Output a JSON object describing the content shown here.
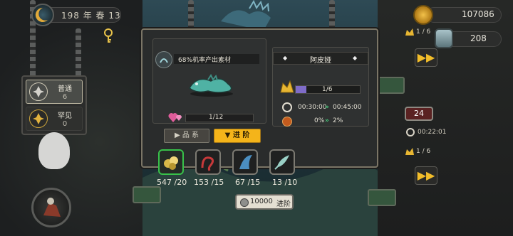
{
  "status_bar": {
    "date": "198 年 春 13"
  },
  "resources": {
    "gold": "107086",
    "jars": "208",
    "level_tag_top": "1 / 6",
    "timer_badge": "24",
    "timer_value": "00:22:01",
    "level_tag_bottom": "1 / 6"
  },
  "rarity": [
    {
      "name": "普通",
      "count": "6",
      "selected": true
    },
    {
      "name": "罕见",
      "count": "0",
      "selected": false
    }
  ],
  "dialog": {
    "rate_label": "68%机率产出素材",
    "hearts": "1/12",
    "creature_name": "阿皮娅",
    "level": "1/6",
    "level_fraction": 0.17,
    "time_current": "00:30:00",
    "time_next": "00:45:00",
    "rate_current": "0%",
    "rate_next": "2%",
    "tabs": [
      {
        "label": "品 系",
        "icon": "play-icon",
        "active": false
      },
      {
        "label": "进 阶",
        "icon": "triangle-down-icon",
        "active": true
      }
    ],
    "materials": [
      {
        "have": "547",
        "need": "/20",
        "icon": "gold-nugget-icon",
        "selected": true
      },
      {
        "have": "153",
        "need": "/15",
        "icon": "red-worm-icon",
        "selected": false
      },
      {
        "have": "67",
        "need": "/15",
        "icon": "blue-fin-icon",
        "selected": false
      },
      {
        "have": "13",
        "need": "/10",
        "icon": "green-feather-icon",
        "selected": false
      }
    ],
    "advance_button": {
      "cost": "10000",
      "label": "进阶"
    }
  },
  "colors": {
    "accent_yellow": "#f4b41a",
    "selected_green": "#38c24a",
    "level_purple": "#7f6cc8"
  }
}
